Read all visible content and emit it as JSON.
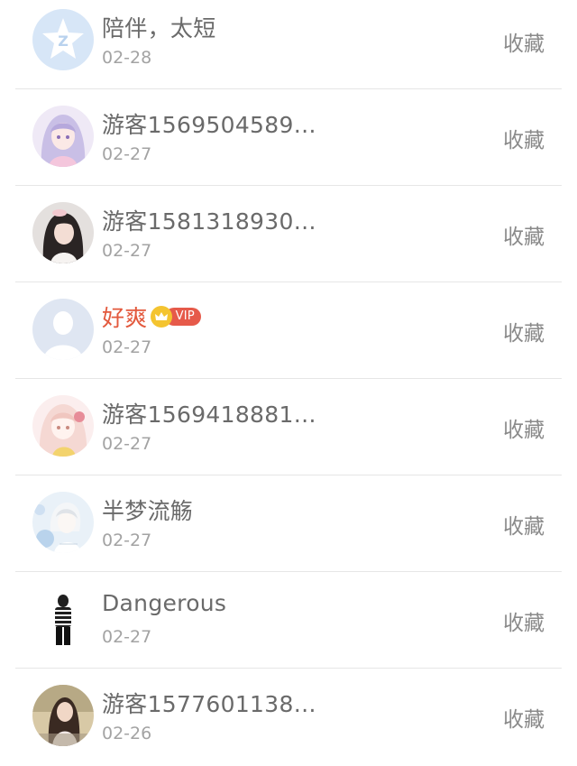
{
  "items": [
    {
      "name": "陪伴，太短",
      "date": "02-28",
      "action": "收藏",
      "avatar_icon": "qq-star-avatar-icon"
    },
    {
      "name": "游客1569504589…",
      "date": "02-27",
      "action": "收藏",
      "avatar_icon": "anime-girl-avatar-icon"
    },
    {
      "name": "游客1581318930…",
      "date": "02-27",
      "action": "收藏",
      "avatar_icon": "girl-photo-avatar-icon"
    },
    {
      "name": "好爽",
      "date": "02-27",
      "action": "收藏",
      "avatar_icon": "default-person-avatar-icon",
      "vip_label": "VIP"
    },
    {
      "name": "游客1569418881…",
      "date": "02-27",
      "action": "收藏",
      "avatar_icon": "anime-girl-pink-avatar-icon"
    },
    {
      "name": "半梦流觞",
      "date": "02-27",
      "action": "收藏",
      "avatar_icon": "anime-boy-avatar-icon"
    },
    {
      "name": "Dangerous",
      "date": "02-27",
      "action": "收藏",
      "avatar_icon": "striped-figure-avatar-icon"
    },
    {
      "name": "游客1577601138…",
      "date": "02-26",
      "action": "收藏",
      "avatar_icon": "girl-outdoor-avatar-icon"
    }
  ],
  "colors": {
    "name_text": "#6a6a6a",
    "vip_name_text": "#e3593d",
    "date_text": "#a3a3a3",
    "action_text": "#8a8a8a",
    "divider": "#e6e6e6",
    "vip_pill": "#e65a4a",
    "crown": "#f4c430"
  }
}
